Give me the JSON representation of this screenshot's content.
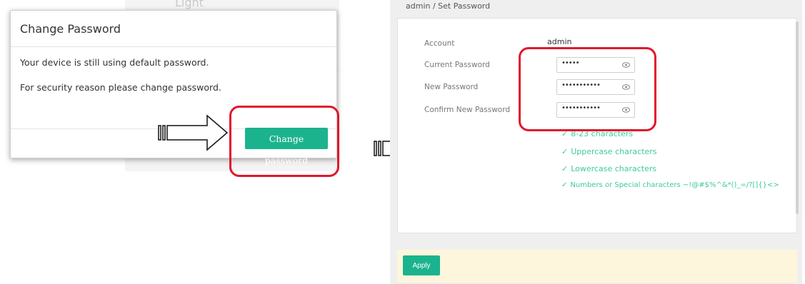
{
  "background": {
    "faint_text": "Light"
  },
  "modal": {
    "title": "Change Password",
    "message_1": "Your device is still using default password.",
    "message_2": "For security reason please change password.",
    "change_button": "Change password"
  },
  "panel": {
    "breadcrumb": "admin / Set Password",
    "account": {
      "label": "Account",
      "value": "admin"
    },
    "current_password": {
      "label": "Current Password",
      "value": "•••••"
    },
    "new_password": {
      "label": "New Password",
      "value": "•••••••••••"
    },
    "confirm_password": {
      "label": "Confirm New Password",
      "value": "•••••••••••"
    },
    "rules": [
      "8-23 characters",
      "Uppercase characters",
      "Lowercase characters",
      "Numbers or Special characters ~!@#$%^&*()_=/?[]{}<>"
    ],
    "apply_button": "Apply"
  },
  "icons": {
    "eye": "eye-icon",
    "check": "check-icon",
    "arrow": "arrow-right-icon"
  },
  "colors": {
    "primary": "#1bb38e",
    "highlight": "#e0182d",
    "rule_text": "#3fc99a",
    "apply_bar": "#fdf6dc"
  }
}
